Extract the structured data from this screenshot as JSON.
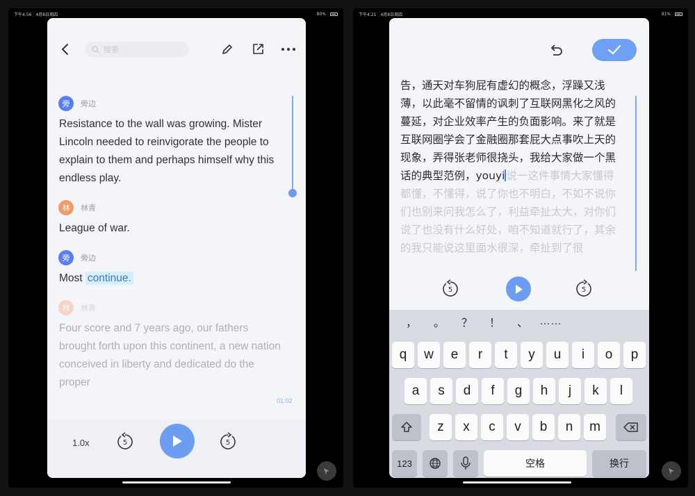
{
  "left_screen": {
    "status": {
      "time": "下午4:56",
      "date": "4月8日周四",
      "battery": "80%"
    },
    "search_placeholder": "搜索",
    "entries": [
      {
        "avatar": "旁",
        "speaker": "旁边",
        "color": "blue",
        "text": "Resistance to the wall was growing. Mister Lincoln needed to reinvigorate the people to explain to them and perhaps himself why this endless play.",
        "faded": false
      },
      {
        "avatar": "林",
        "speaker": "林青",
        "color": "orange",
        "text": "League of war.",
        "faded": false
      },
      {
        "avatar": "旁",
        "speaker": "旁边",
        "color": "blue",
        "text_before": "Most ",
        "text_highlight": "continue.",
        "faded": false
      },
      {
        "avatar": "林",
        "speaker": "林青",
        "color": "orange",
        "text": "Four score and 7 years ago, our fathers brought forth upon this continent, a new nation conceived in liberty and dedicated do the proper",
        "faded": true
      }
    ],
    "timestamp": "01:02",
    "player": {
      "speed": "1.0x",
      "skip_back": "5",
      "skip_forward": "5"
    }
  },
  "right_screen": {
    "status": {
      "time": "下午4:21",
      "date": "4月8日周四",
      "battery": "91%"
    },
    "editor_text_main": "告，通天对车狗屁有虚幻的概念，浮躁又浅薄，以此毫不留情的讽刺了互联网黑化之风的蔓延，对企业效率产生的负面影响。来了就是互联网圈学会了金融圈那套屁大点事吹上天的现象，弄得张老师很挠头，我给大家做一个黑话的典型范例，youyi",
    "editor_text_faded": "说一这件事情大家懂得都懂，不懂得，说了你也不明白，不如不说你们也别来问我怎么了，利益牵扯太大，对你们说了也没有什么好处，咱不知道就行了，其余的我只能说这里面水很深，牵扯到了很",
    "controls": {
      "skip_back": "5",
      "skip_forward": "5"
    },
    "keyboard": {
      "punctuation": [
        "，",
        "。",
        "？",
        "！",
        "、",
        "……"
      ],
      "row1": [
        "q",
        "w",
        "e",
        "r",
        "t",
        "y",
        "u",
        "i",
        "o",
        "p"
      ],
      "row2": [
        "a",
        "s",
        "d",
        "f",
        "g",
        "h",
        "j",
        "k",
        "l"
      ],
      "row3": [
        "z",
        "x",
        "c",
        "v",
        "b",
        "n",
        "m"
      ],
      "numbers_key": "123",
      "space_key": "空格",
      "return_key": "换行"
    }
  },
  "colors": {
    "accent": "#6c9df0",
    "avatar_blue": "#5a7df0",
    "avatar_orange": "#f19a6a",
    "highlight_bg": "#d7eefb"
  }
}
